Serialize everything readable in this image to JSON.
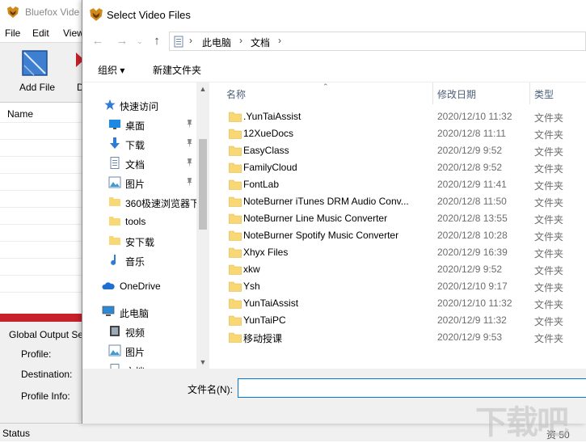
{
  "app": {
    "title": "Bluefox Vide",
    "menu": [
      "File",
      "Edit",
      "View"
    ],
    "toolbar": {
      "add_file": "Add File",
      "d_label": "D"
    },
    "list": {
      "col_name": "Name"
    },
    "settings": {
      "header": "Global Output Setti",
      "profile": "Profile:",
      "destination": "Destination:",
      "profile_info": "Profile Info:"
    },
    "status": "Status",
    "status_right": "资 50",
    "colors": {
      "accent_red": "#c8202a"
    }
  },
  "dialog": {
    "title": "Select Video Files",
    "breadcrumb": [
      "此电脑",
      "文档"
    ],
    "commands": {
      "organize": "组织 ▾",
      "new_folder": "新建文件夹"
    },
    "nav": {
      "quick_access": "快速访问",
      "items": [
        {
          "label": "桌面",
          "icon": "desktop-icon",
          "pinned": true
        },
        {
          "label": "下载",
          "icon": "download-icon",
          "pinned": true
        },
        {
          "label": "文档",
          "icon": "document-icon",
          "pinned": true
        },
        {
          "label": "图片",
          "icon": "picture-icon",
          "pinned": true
        },
        {
          "label": "360极速浏览器下",
          "icon": "folder-icon",
          "pinned": false
        },
        {
          "label": "tools",
          "icon": "folder-icon",
          "pinned": false
        },
        {
          "label": "安下载",
          "icon": "folder-icon",
          "pinned": false
        },
        {
          "label": "音乐",
          "icon": "music-icon",
          "pinned": false
        }
      ],
      "onedrive": "OneDrive",
      "this_pc": "此电脑",
      "pc_items": [
        {
          "label": "视频",
          "icon": "video-icon"
        },
        {
          "label": "图片",
          "icon": "picture-icon"
        },
        {
          "label": "文档",
          "icon": "document-icon"
        }
      ]
    },
    "columns": {
      "name": "名称",
      "modified": "修改日期",
      "type": "类型"
    },
    "files": [
      {
        "name": ".YunTaiAssist",
        "date": "2020/12/10 11:32",
        "type": "文件夹"
      },
      {
        "name": "12XueDocs",
        "date": "2020/12/8 11:11",
        "type": "文件夹"
      },
      {
        "name": "EasyClass",
        "date": "2020/12/9 9:52",
        "type": "文件夹"
      },
      {
        "name": "FamilyCloud",
        "date": "2020/12/8 9:52",
        "type": "文件夹"
      },
      {
        "name": "FontLab",
        "date": "2020/12/9 11:41",
        "type": "文件夹"
      },
      {
        "name": "NoteBurner iTunes DRM Audio Conv...",
        "date": "2020/12/8 11:50",
        "type": "文件夹"
      },
      {
        "name": "NoteBurner Line Music Converter",
        "date": "2020/12/8 13:55",
        "type": "文件夹"
      },
      {
        "name": "NoteBurner Spotify Music Converter",
        "date": "2020/12/8 10:28",
        "type": "文件夹"
      },
      {
        "name": "Xhyx Files",
        "date": "2020/12/9 16:39",
        "type": "文件夹"
      },
      {
        "name": "xkw",
        "date": "2020/12/9 9:52",
        "type": "文件夹"
      },
      {
        "name": "Ysh",
        "date": "2020/12/10 9:17",
        "type": "文件夹"
      },
      {
        "name": "YunTaiAssist",
        "date": "2020/12/10 11:32",
        "type": "文件夹"
      },
      {
        "name": "YunTaiPC",
        "date": "2020/12/9 11:32",
        "type": "文件夹"
      },
      {
        "name": "移动授课",
        "date": "2020/12/9 9:53",
        "type": "文件夹"
      }
    ],
    "filename_label": "文件名(N):",
    "filename_value": ""
  },
  "watermark": "下载吧"
}
